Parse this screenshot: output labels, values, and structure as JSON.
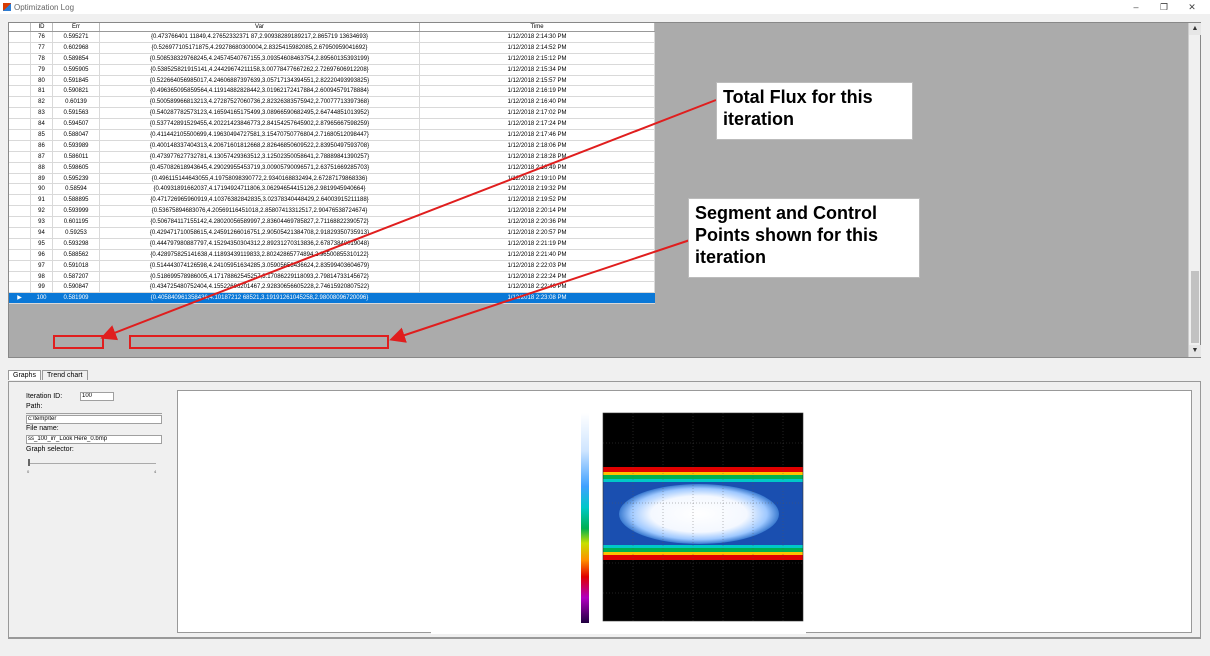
{
  "window": {
    "title": "Optimization Log",
    "minimize": "–",
    "restore": "❐",
    "close": "✕"
  },
  "grid": {
    "headers": {
      "id": "ID",
      "err": "Err",
      "var": "Var",
      "time": "Time"
    },
    "rows": [
      {
        "id": "76",
        "err": "0.595271",
        "var": "{0.473766401 11849,4.27652332371 87,2.90938289189217,2.865719 13634693}",
        "time": "1/12/2018 2:14:30 PM"
      },
      {
        "id": "77",
        "err": "0.602968",
        "var": "{0.526977105171875,4.29278680300004,2.8325415982085,2.67950959041692}",
        "time": "1/12/2018 2:14:52 PM"
      },
      {
        "id": "78",
        "err": "0.589854",
        "var": "{0.508538329768245,4.24574540767155,3.09354608463754,2.89560135393199}",
        "time": "1/12/2018 2:15:12 PM"
      },
      {
        "id": "79",
        "err": "0.595905",
        "var": "{0.538525821915141,4.24429674211158,3.00778477667262,2.72697606912208}",
        "time": "1/12/2018 2:15:34 PM"
      },
      {
        "id": "80",
        "err": "0.591845",
        "var": "{0.522664056985017,4.24606887397639,3.05717134394551,2.82220493993825}",
        "time": "1/12/2018 2:15:57 PM"
      },
      {
        "id": "81",
        "err": "0.590821",
        "var": "{0.496365095859564,4.11914882828442,3.01962172417884,2.60094579178884}",
        "time": "1/12/2018 2:16:19 PM"
      },
      {
        "id": "82",
        "err": "0.60139",
        "var": "{0.500589966813213,4.27287527060736,2.82326383575942,2.70077713397368}",
        "time": "1/12/2018 2:16:40 PM"
      },
      {
        "id": "83",
        "err": "0.591563",
        "var": "{0.540287782573123,4.16594165175499,3.08966590682495,2.64744851013952}",
        "time": "1/12/2018 2:17:02 PM"
      },
      {
        "id": "84",
        "err": "0.594507",
        "var": "{0.537742891529455,4.20221423846773,2.84154257645902,2.87965667598259}",
        "time": "1/12/2018 2:17:24 PM"
      },
      {
        "id": "85",
        "err": "0.588047",
        "var": "{0.411442105500699,4.19630494727581,3.15470750776804,2.71680512098447}",
        "time": "1/12/2018 2:17:46 PM"
      },
      {
        "id": "86",
        "err": "0.593989",
        "var": "{0.400148337404313,4.20671601812668,2.82646850609522,2.83950497593708}",
        "time": "1/12/2018 2:18:06 PM"
      },
      {
        "id": "87",
        "err": "0.586011",
        "var": "{0.473977627732781,4.13057429363512,3.12502350058641,2.78889841390257}",
        "time": "1/12/2018 2:18:28 PM"
      },
      {
        "id": "88",
        "err": "0.598605",
        "var": "{0.457082618943645,4.29029955453719,3.00905790096571,2.63751669285703}",
        "time": "1/12/2018 2:18:49 PM"
      },
      {
        "id": "89",
        "err": "0.595239",
        "var": "{0.496115144643055,4.19758098390772,2.9340168832494,2.67287179868336}",
        "time": "1/12/2018 2:19:10 PM"
      },
      {
        "id": "90",
        "err": "0.58594",
        "var": "{0.40931891662037,4.17194924711806,3.06294654415126,2.9819945940664}",
        "time": "1/12/2018 2:19:32 PM"
      },
      {
        "id": "91",
        "err": "0.588895",
        "var": "{0.471726965960919,4.10376382842835,3.02378340448429,2.64003915211188}",
        "time": "1/12/2018 2:19:52 PM"
      },
      {
        "id": "92",
        "err": "0.593999",
        "var": "{0.53675894683076,4.20569116451018,2.85807413312517,2.90476538724674}",
        "time": "1/12/2018 2:20:14 PM"
      },
      {
        "id": "93",
        "err": "0.601195",
        "var": "{0.506784117155142,4.28020056589997,2.83604469785827,2.71168822390572}",
        "time": "1/12/2018 2:20:36 PM"
      },
      {
        "id": "94",
        "err": "0.59253",
        "var": "{0.429471710058615,4.24591266016751,2.90505421384708,2.91829350735913}",
        "time": "1/12/2018 2:20:57 PM"
      },
      {
        "id": "95",
        "err": "0.593298",
        "var": "{0.444797980887797,4.15294350304312,2.89231270313836,2.67873840019048}",
        "time": "1/12/2018 2:21:19 PM"
      },
      {
        "id": "96",
        "err": "0.588562",
        "var": "{0.428975825141638,4.11893439119833,2.80242865774894,2.96500855310122}",
        "time": "1/12/2018 2:21:40 PM"
      },
      {
        "id": "97",
        "err": "0.591018",
        "var": "{0.514443074126598,4.24105951634285,3.05905653436624,2.83599403604679}",
        "time": "1/12/2018 2:22:03 PM"
      },
      {
        "id": "98",
        "err": "0.587207",
        "var": "{0.518699578986005,4.17178862545257,3.17086229118093,2.79814733145672}",
        "time": "1/12/2018 2:22:24 PM"
      },
      {
        "id": "99",
        "err": "0.590847",
        "var": "{0.434725480752404,4.15522696201467,2.92830656605228,2.74615920807522}",
        "time": "1/12/2018 2:22:46 PM"
      },
      {
        "id": "100",
        "err": "0.581909",
        "var": "{0.405840961358436,4.10187212 68521,3.19191261045258,2.98008096720096}",
        "time": "1/12/2018 2:23:08 PM",
        "selected": true
      }
    ]
  },
  "tabs": [
    {
      "label": "Graphs",
      "active": true
    },
    {
      "label": "Trend chart",
      "active": false
    }
  ],
  "panel": {
    "iteration_label": "Iteration ID:",
    "iteration_value": "100",
    "path_label": "Path:",
    "path_value": "c:\\temp\\ter",
    "file_label": "File name:",
    "file_value": "ss_100_irr_Look Here_0.bmp",
    "graph_selector_label": "Graph selector:",
    "slider_min": "0",
    "slider_max": "4"
  },
  "callouts": {
    "flux": "Total Flux for this iteration",
    "segment": "Segment and Control Points shown for this iteration"
  },
  "colors": {
    "selected_row": "#0a78d7",
    "annotation": "#e01e1e"
  }
}
